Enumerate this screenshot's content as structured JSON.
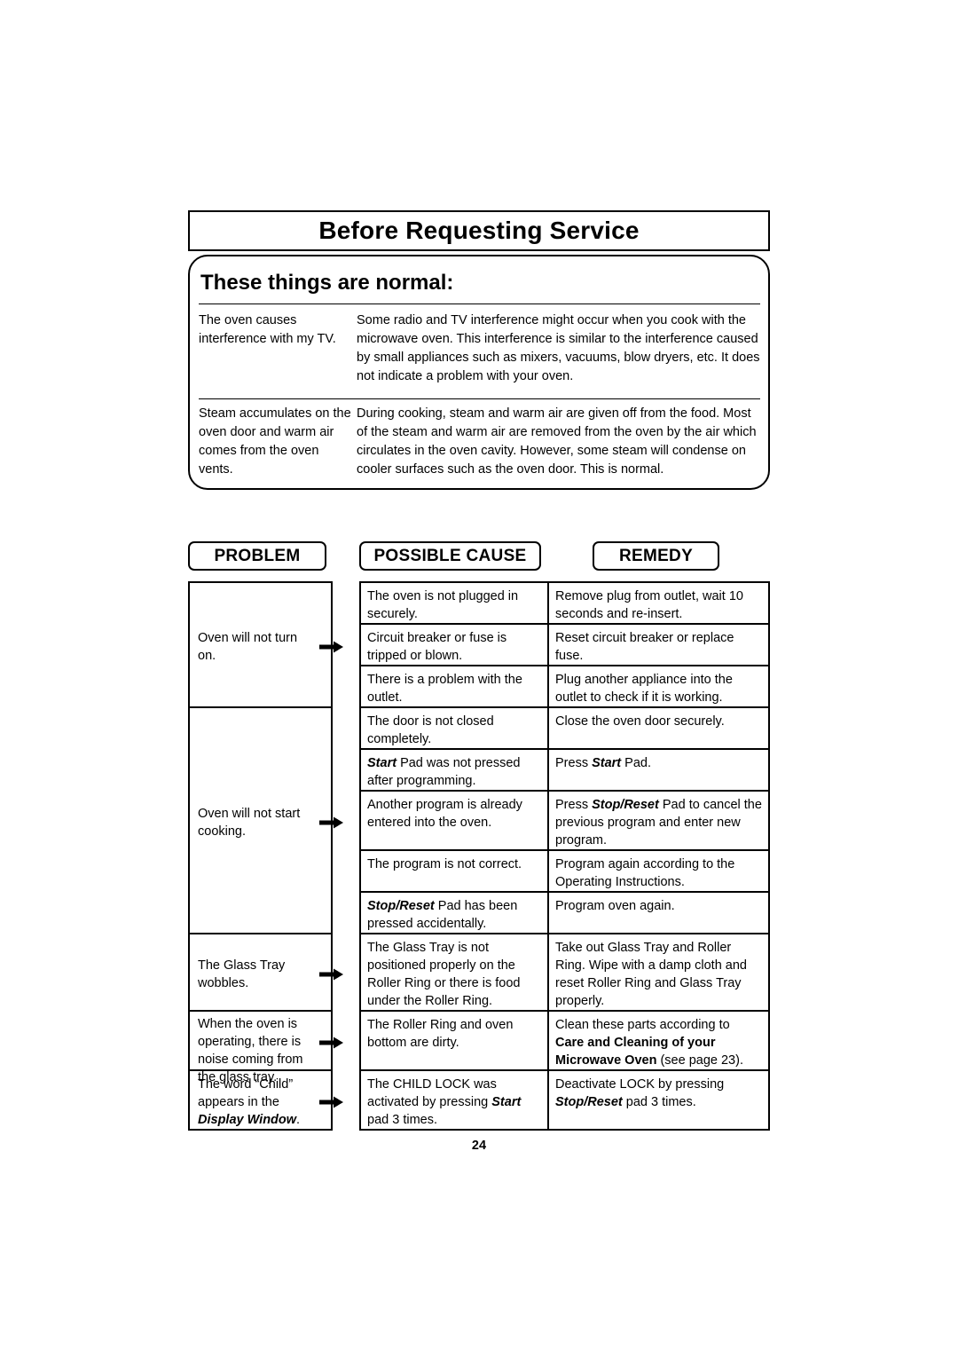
{
  "header": {
    "title": "Before Requesting Service"
  },
  "normal_section": {
    "heading": "These things are normal:",
    "rows": [
      {
        "problem": "The oven causes interference with my TV.",
        "explanation": "Some radio and TV interference might occur when you cook with the microwave oven. This interference is similar to the interference caused by small appliances such as mixers, vacuums, blow dryers, etc. It does not indicate a problem with your oven."
      },
      {
        "problem": "Steam accumulates on the oven door and warm air comes from the oven vents.",
        "explanation": "During cooking, steam and warm air are given off from the food. Most of the steam and warm air are removed from the oven by the air which circulates in the oven cavity. However, some steam will condense on cooler surfaces such as the oven door. This is normal."
      }
    ]
  },
  "table": {
    "headers": {
      "problem": "PROBLEM",
      "cause": "POSSIBLE CAUSE",
      "remedy": "REMEDY"
    },
    "groups": [
      {
        "problem": "Oven will not turn on.",
        "rows": [
          {
            "cause": "The oven is not plugged in securely.",
            "remedy": "Remove plug from outlet, wait 10 seconds and re-insert."
          },
          {
            "cause": "Circuit breaker or fuse is tripped or blown.",
            "remedy": "Reset circuit breaker or replace fuse."
          },
          {
            "cause": "There is a problem with the outlet.",
            "remedy": "Plug another appliance into the outlet to check if it is working."
          }
        ]
      },
      {
        "problem": "Oven will not start cooking.",
        "rows": [
          {
            "cause": "The door is not closed completely.",
            "remedy": "Close the oven door securely."
          },
          {
            "cause_html": "<span class=\"bi\">Start</span> Pad was not pressed after programming.",
            "remedy_html": "Press <span class=\"bi\">Start</span> Pad."
          },
          {
            "cause": "Another program is already entered into the oven.",
            "remedy_html": "Press <span class=\"bi\">Stop/Reset</span> Pad to cancel the previous program and enter new program."
          },
          {
            "cause": "The program is not correct.",
            "remedy": "Program again according to the Operating Instructions."
          },
          {
            "cause_html": "<span class=\"bi\">Stop/Reset</span> Pad has been pressed accidentally.",
            "remedy": "Program oven again."
          }
        ]
      },
      {
        "problem": "The Glass Tray wobbles.",
        "rows": [
          {
            "cause": "The Glass Tray is not positioned properly on the Roller Ring or there is food under the Roller Ring.",
            "remedy": "Take out Glass Tray and Roller Ring. Wipe with a damp cloth and reset Roller Ring and Glass Tray properly."
          }
        ]
      },
      {
        "problem": "When the oven is operating, there is noise coming from the glass tray.",
        "rows": [
          {
            "cause": "The Roller Ring and oven bottom are dirty.",
            "remedy_html": "Clean these parts according to<br><b>Care and Cleaning of your</b><br><b>Microwave Oven</b> (see page 23)."
          }
        ]
      },
      {
        "problem_html": "The word “Child” appears in the<br><span class=\"bi\">Display Window</span>.",
        "rows": [
          {
            "cause_html": "The CHILD LOCK was activated by pressing <span class=\"bi\">Start</span> pad 3 times.",
            "remedy_html": "Deactivate LOCK by pressing <span class=\"bi\">Stop/Reset</span> pad 3 times."
          }
        ]
      }
    ]
  },
  "footer": {
    "page_number": "24"
  }
}
